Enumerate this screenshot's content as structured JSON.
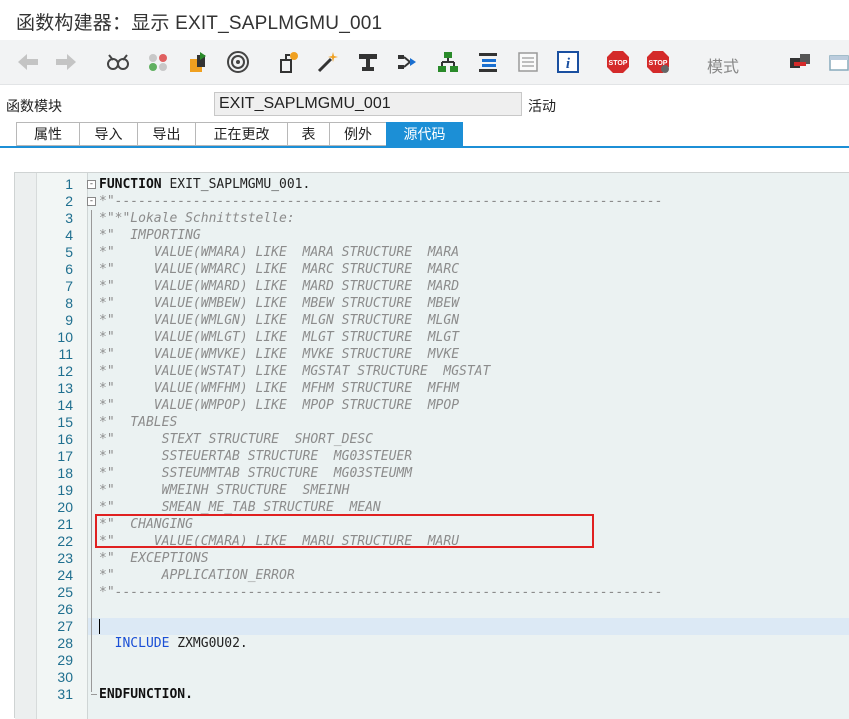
{
  "window": {
    "title": "函数构建器：显示 EXIT_SAPLMGMU_001"
  },
  "toolbar": {
    "icons": [
      "back-arrow-icon",
      "forward-arrow-icon",
      "glasses-icon",
      "balls-icon",
      "transport-icon",
      "target-icon",
      "object-tree-icon",
      "magic-wand-icon",
      "stamp-icon",
      "branch-icon",
      "hierarchy-icon",
      "stack-icon",
      "page-icon",
      "info-icon",
      "stop-icon",
      "stop-red-icon",
      "display-object-icon",
      "layout-icon"
    ],
    "mode_label": "模式"
  },
  "function_module": {
    "label": "函数模块",
    "name": "EXIT_SAPLMGMU_001",
    "status": "活动"
  },
  "tabs": [
    {
      "label": "属性"
    },
    {
      "label": "导入"
    },
    {
      "label": "导出"
    },
    {
      "label": "正在更改"
    },
    {
      "label": "表"
    },
    {
      "label": "例外"
    },
    {
      "label": "源代码",
      "active": true
    }
  ],
  "editor": {
    "lines": [
      {
        "n": "1",
        "t": "FUNCTION EXIT_SAPLMGMU_001.",
        "k": "fn"
      },
      {
        "n": "2",
        "t": "*\"----------------------------------------------------------------------",
        "k": "cm"
      },
      {
        "n": "3",
        "t": "*\"*\"Lokale Schnittstelle:",
        "k": "cm"
      },
      {
        "n": "4",
        "t": "*\"  IMPORTING",
        "k": "cm"
      },
      {
        "n": "5",
        "t": "*\"     VALUE(WMARA) LIKE  MARA STRUCTURE  MARA",
        "k": "cm"
      },
      {
        "n": "6",
        "t": "*\"     VALUE(WMARC) LIKE  MARC STRUCTURE  MARC",
        "k": "cm"
      },
      {
        "n": "7",
        "t": "*\"     VALUE(WMARD) LIKE  MARD STRUCTURE  MARD",
        "k": "cm"
      },
      {
        "n": "8",
        "t": "*\"     VALUE(WMBEW) LIKE  MBEW STRUCTURE  MBEW",
        "k": "cm"
      },
      {
        "n": "9",
        "t": "*\"     VALUE(WMLGN) LIKE  MLGN STRUCTURE  MLGN",
        "k": "cm"
      },
      {
        "n": "10",
        "t": "*\"     VALUE(WMLGT) LIKE  MLGT STRUCTURE  MLGT",
        "k": "cm"
      },
      {
        "n": "11",
        "t": "*\"     VALUE(WMVKE) LIKE  MVKE STRUCTURE  MVKE",
        "k": "cm"
      },
      {
        "n": "12",
        "t": "*\"     VALUE(WSTAT) LIKE  MGSTAT STRUCTURE  MGSTAT",
        "k": "cm"
      },
      {
        "n": "13",
        "t": "*\"     VALUE(WMFHM) LIKE  MFHM STRUCTURE  MFHM",
        "k": "cm"
      },
      {
        "n": "14",
        "t": "*\"     VALUE(WMPOP) LIKE  MPOP STRUCTURE  MPOP",
        "k": "cm"
      },
      {
        "n": "15",
        "t": "*\"  TABLES",
        "k": "cm"
      },
      {
        "n": "16",
        "t": "*\"      STEXT STRUCTURE  SHORT_DESC",
        "k": "cm"
      },
      {
        "n": "17",
        "t": "*\"      SSTEUERTAB STRUCTURE  MG03STEUER",
        "k": "cm"
      },
      {
        "n": "18",
        "t": "*\"      SSTEUMMTAB STRUCTURE  MG03STEUMM",
        "k": "cm"
      },
      {
        "n": "19",
        "t": "*\"      WMEINH STRUCTURE  SMEINH",
        "k": "cm"
      },
      {
        "n": "20",
        "t": "*\"      SMEAN_ME_TAB STRUCTURE  MEAN",
        "k": "cm"
      },
      {
        "n": "21",
        "t": "*\"  CHANGING",
        "k": "cm"
      },
      {
        "n": "22",
        "t": "*\"     VALUE(CMARA) LIKE  MARU STRUCTURE  MARU",
        "k": "cm"
      },
      {
        "n": "23",
        "t": "*\"  EXCEPTIONS",
        "k": "cm"
      },
      {
        "n": "24",
        "t": "*\"      APPLICATION_ERROR",
        "k": "cm"
      },
      {
        "n": "25",
        "t": "*\"----------------------------------------------------------------------",
        "k": "cm"
      },
      {
        "n": "26",
        "t": "",
        "k": "plain"
      },
      {
        "n": "27",
        "t": "",
        "k": "plain",
        "current": true
      },
      {
        "n": "28",
        "t": "  INCLUDE ZXMG0U02.",
        "k": "inc"
      },
      {
        "n": "29",
        "t": "",
        "k": "plain"
      },
      {
        "n": "30",
        "t": "",
        "k": "plain"
      },
      {
        "n": "31",
        "t": "ENDFUNCTION.",
        "k": "fn"
      }
    ]
  }
}
